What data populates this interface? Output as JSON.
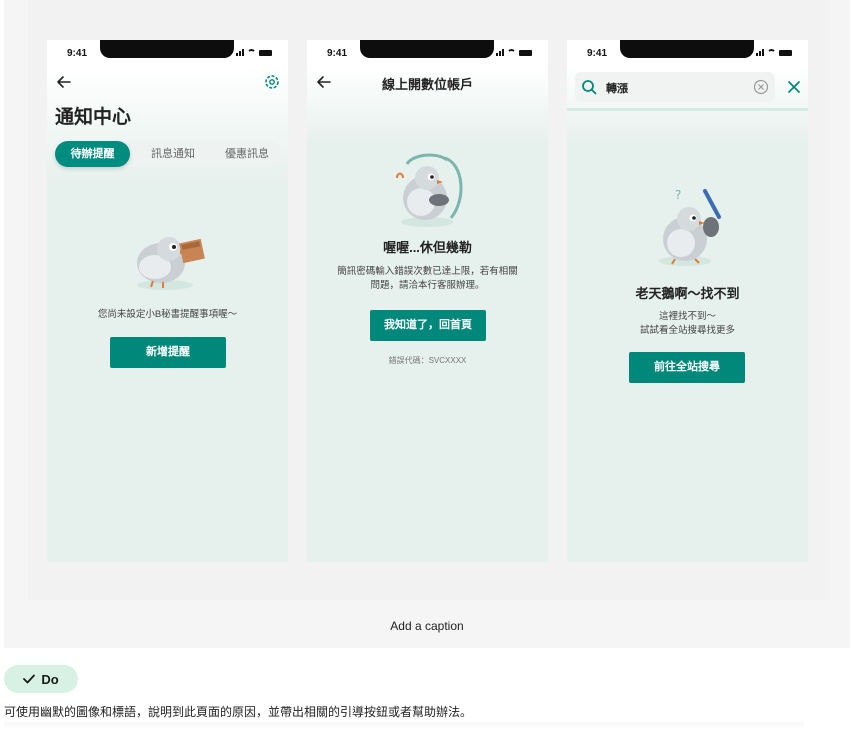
{
  "status_time": "9:41",
  "screens": [
    {
      "title": "通知中心",
      "tabs": [
        "待辦提醒",
        "訊息通知",
        "優惠訊息"
      ],
      "message": "您尚未設定小B秘書提醒事項喔～",
      "button": "新增提醒"
    },
    {
      "title": "線上開數位帳戶",
      "heading": "喔喔...休但幾勒",
      "message_line1": "簡訊密碼輸入錯誤次數已達上限，若有相關",
      "message_line2": "問題，請洽本行客服辦理。",
      "button": "我知道了，回首頁",
      "error_code": "錯誤代碼：SVCXXXX"
    },
    {
      "search_value": "轉漲",
      "heading": "老天鵝啊～找不到",
      "message_line1": "這裡找不到～",
      "message_line2": "試試看全站搜尋找更多",
      "button": "前往全站搜尋"
    }
  ],
  "caption": "Add a caption",
  "do_label": "Do",
  "do_note": "可使用幽默的圖像和標語，說明到此頁面的原因，並帶出相關的引導按鈕或者幫助辦法。",
  "colors": {
    "accent": "#00897a",
    "screen_bg": "#e6f0ed",
    "do_badge_bg": "#d7f1e4"
  }
}
